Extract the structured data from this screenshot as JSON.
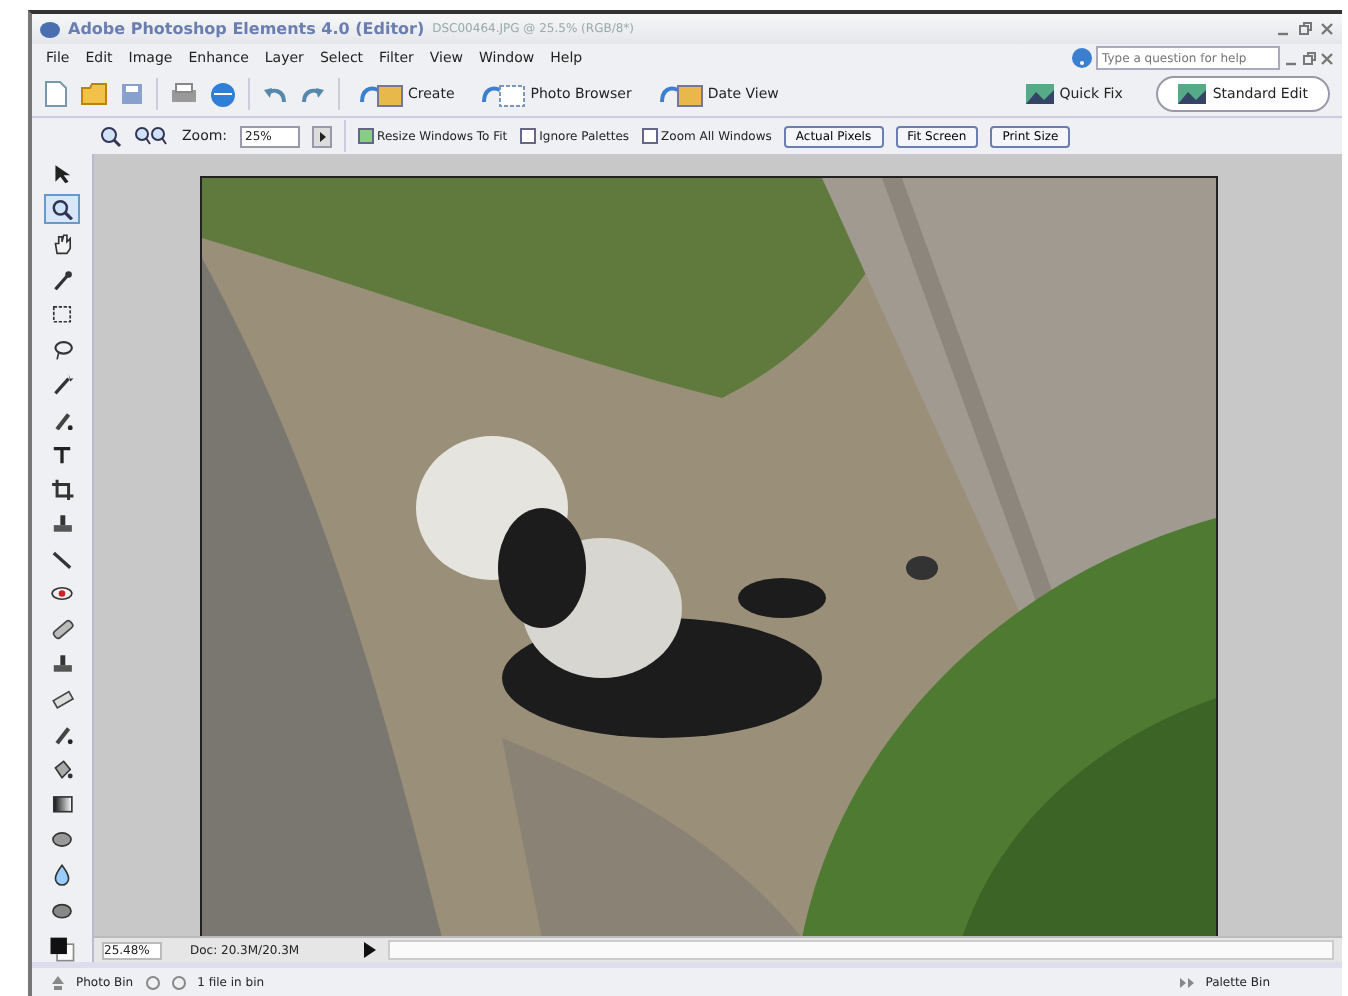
{
  "window": {
    "title": "Adobe Photoshop Elements 4.0 (Editor)",
    "document": "DSC00464.JPG @ 25.5% (RGB/8*)"
  },
  "menu": [
    "File",
    "Edit",
    "Image",
    "Enhance",
    "Layer",
    "Select",
    "Filter",
    "View",
    "Window",
    "Help"
  ],
  "help_search": {
    "placeholder": "Type a question for help"
  },
  "shortcuts": [
    {
      "label": "Create"
    },
    {
      "label": "Photo Browser"
    },
    {
      "label": "Date View"
    }
  ],
  "modes": [
    {
      "label": "Quick Fix",
      "selected": false
    },
    {
      "label": "Standard Edit",
      "selected": true
    }
  ],
  "options": {
    "zoom_label": "Zoom:",
    "zoom_value": "25%",
    "checkboxes": [
      {
        "label": "Resize Windows To Fit",
        "checked": true
      },
      {
        "label": "Ignore Palettes",
        "checked": false
      },
      {
        "label": "Zoom All Windows",
        "checked": false
      }
    ],
    "buttons": [
      "Actual Pixels",
      "Fit Screen",
      "Print Size"
    ]
  },
  "tools": [
    {
      "kind": "move",
      "selected": false
    },
    {
      "kind": "zoom",
      "selected": true
    },
    {
      "kind": "hand",
      "selected": false
    },
    {
      "kind": "eyedropper",
      "selected": false
    },
    {
      "kind": "marquee",
      "selected": false
    },
    {
      "kind": "lasso",
      "selected": false
    },
    {
      "kind": "wand",
      "selected": false
    },
    {
      "kind": "brush",
      "selected": false
    },
    {
      "kind": "type",
      "selected": false
    },
    {
      "kind": "crop",
      "selected": false
    },
    {
      "kind": "stamp",
      "selected": false
    },
    {
      "kind": "line",
      "selected": false
    },
    {
      "kind": "eye",
      "selected": false
    },
    {
      "kind": "bandage",
      "selected": false
    },
    {
      "kind": "stamp",
      "selected": false
    },
    {
      "kind": "eraser",
      "selected": false
    },
    {
      "kind": "brush",
      "selected": false
    },
    {
      "kind": "bucket",
      "selected": false
    },
    {
      "kind": "gradient",
      "selected": false
    },
    {
      "kind": "shape",
      "selected": false
    },
    {
      "kind": "drop",
      "selected": false
    },
    {
      "kind": "sponge",
      "selected": false
    }
  ],
  "status_bar": {
    "zoom": "25.48%",
    "doc": "Doc: 20.3M/20.3M"
  },
  "bins": {
    "photo_bin": "Photo Bin",
    "file_count": "1 file in bin",
    "palette_bin": "Palette Bin"
  }
}
